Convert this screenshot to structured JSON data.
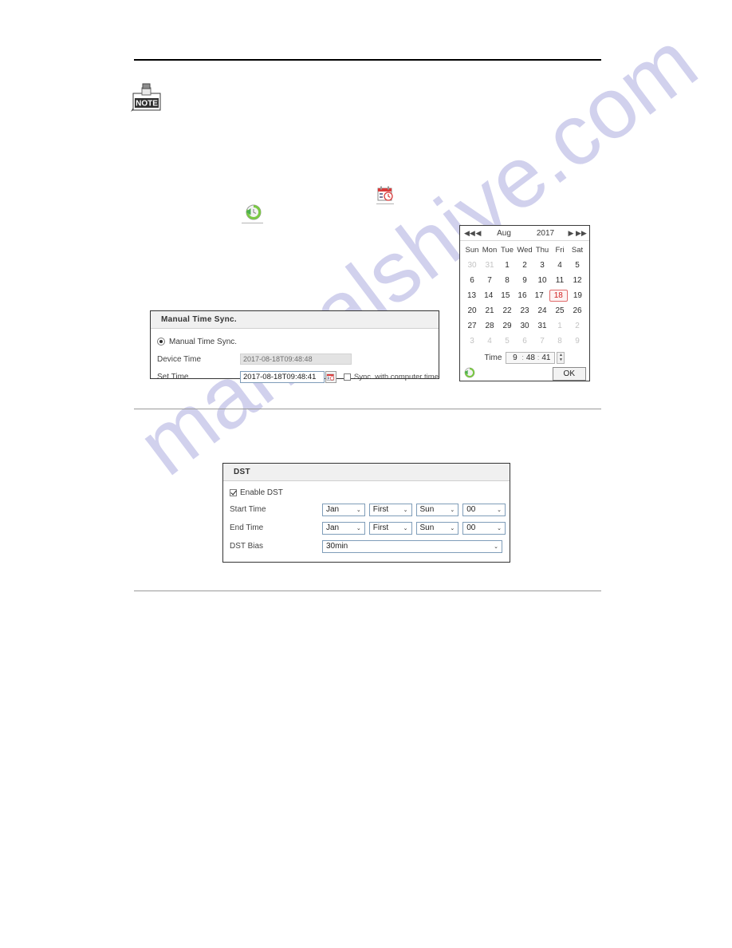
{
  "page": {
    "note_icon_label": "NOTE",
    "watermark": "manualshive.com"
  },
  "inline_icons": {
    "calendar_icon": "calendar-icon",
    "sync_icon": "sync-refresh-icon"
  },
  "manual_time_sync": {
    "panel_title": "Manual Time Sync.",
    "radio_label": "Manual Time Sync.",
    "radio_checked": true,
    "device_time_label": "Device Time",
    "device_time_value": "2017-08-18T09:48:48",
    "set_time_label": "Set Time",
    "set_time_value": "2017-08-18T09:48:41",
    "calendar_button_icon": "calendar-icon",
    "sync_computer_label": "Sync. with computer time",
    "sync_computer_checked": false
  },
  "calendar": {
    "nav": {
      "first": "◀◀",
      "prev": "◀",
      "next": "▶",
      "last": "▶▶"
    },
    "month": "Aug",
    "year": "2017",
    "day_headers": [
      "Sun",
      "Mon",
      "Tue",
      "Wed",
      "Thu",
      "Fri",
      "Sat"
    ],
    "weeks": [
      [
        {
          "d": "30",
          "t": "other"
        },
        {
          "d": "31",
          "t": "other"
        },
        {
          "d": "1",
          "t": "cur"
        },
        {
          "d": "2",
          "t": "cur"
        },
        {
          "d": "3",
          "t": "cur"
        },
        {
          "d": "4",
          "t": "cur"
        },
        {
          "d": "5",
          "t": "cur"
        }
      ],
      [
        {
          "d": "6",
          "t": "cur"
        },
        {
          "d": "7",
          "t": "cur"
        },
        {
          "d": "8",
          "t": "cur"
        },
        {
          "d": "9",
          "t": "cur"
        },
        {
          "d": "10",
          "t": "cur"
        },
        {
          "d": "11",
          "t": "cur"
        },
        {
          "d": "12",
          "t": "cur"
        }
      ],
      [
        {
          "d": "13",
          "t": "cur"
        },
        {
          "d": "14",
          "t": "cur"
        },
        {
          "d": "15",
          "t": "cur"
        },
        {
          "d": "16",
          "t": "cur"
        },
        {
          "d": "17",
          "t": "cur"
        },
        {
          "d": "18",
          "t": "sel"
        },
        {
          "d": "19",
          "t": "cur"
        }
      ],
      [
        {
          "d": "20",
          "t": "cur"
        },
        {
          "d": "21",
          "t": "cur"
        },
        {
          "d": "22",
          "t": "cur"
        },
        {
          "d": "23",
          "t": "cur"
        },
        {
          "d": "24",
          "t": "cur"
        },
        {
          "d": "25",
          "t": "cur"
        },
        {
          "d": "26",
          "t": "cur"
        }
      ],
      [
        {
          "d": "27",
          "t": "cur"
        },
        {
          "d": "28",
          "t": "cur"
        },
        {
          "d": "29",
          "t": "cur"
        },
        {
          "d": "30",
          "t": "cur"
        },
        {
          "d": "31",
          "t": "cur"
        },
        {
          "d": "1",
          "t": "other"
        },
        {
          "d": "2",
          "t": "other"
        }
      ],
      [
        {
          "d": "3",
          "t": "other"
        },
        {
          "d": "4",
          "t": "other"
        },
        {
          "d": "5",
          "t": "other"
        },
        {
          "d": "6",
          "t": "other"
        },
        {
          "d": "7",
          "t": "other"
        },
        {
          "d": "8",
          "t": "other"
        },
        {
          "d": "9",
          "t": "other"
        }
      ]
    ],
    "selected_day": "18",
    "time_label": "Time",
    "time_hour": "9",
    "time_minute": "48",
    "time_second": "41",
    "colon": ":",
    "spinner_up": "▲",
    "spinner_down": "▼",
    "sync_icon": "sync-refresh-icon",
    "ok_label": "OK"
  },
  "dst": {
    "panel_title": "DST",
    "enable_label": "Enable DST",
    "enable_checked": true,
    "start_time_label": "Start Time",
    "end_time_label": "End Time",
    "bias_label": "DST Bias",
    "start_time": {
      "month": "Jan",
      "week": "First",
      "day": "Sun",
      "hour": "00"
    },
    "end_time": {
      "month": "Jan",
      "week": "First",
      "day": "Sun",
      "hour": "00"
    },
    "bias_value": "30min",
    "dropdown_arrow": "⌄"
  },
  "colors": {
    "selected_day_text": "#d02020",
    "selected_day_border": "#e06a6a",
    "panel_header_bg": "#f0f0f0",
    "readonly_bg": "#e3e3e3",
    "input_border": "#7f9db9",
    "watermark": "#c9c9ea",
    "sync_icon_green": "#4caf50",
    "calendar_icon_red": "#d93b3b"
  }
}
